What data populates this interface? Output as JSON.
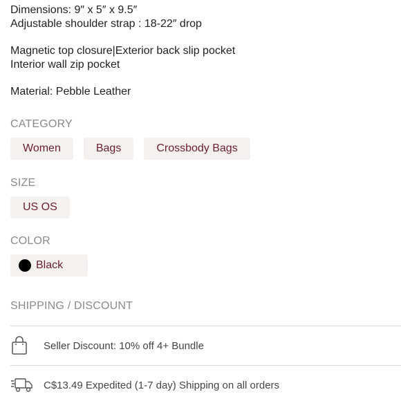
{
  "description": {
    "lines": [
      "Dimensions: 9″ x 5″ x 9.5″",
      "Adjustable shoulder strap : 18-22″ drop",
      "Magnetic top closure|Exterior back slip pocket",
      "Interior wall zip pocket",
      "Material: Pebble Leather"
    ]
  },
  "category": {
    "title": "CATEGORY",
    "items": [
      "Women",
      "Bags",
      "Crossbody Bags"
    ]
  },
  "size": {
    "title": "SIZE",
    "value": "US OS"
  },
  "color": {
    "title": "COLOR",
    "value": "Black",
    "swatch_hex": "#000000"
  },
  "shipping": {
    "title": "SHIPPING / DISCOUNT",
    "rows": [
      {
        "icon": "shopping-bag-icon",
        "text": "Seller Discount: 10% off 4+ Bundle"
      },
      {
        "icon": "delivery-truck-icon",
        "text": "C$13.49 Expedited (1-7 day) Shipping on all orders"
      }
    ]
  },
  "colors": {
    "accent_text": "#6b1f2e",
    "chip_bg": "#f4f1ee",
    "section_title": "#8a8a8a"
  }
}
